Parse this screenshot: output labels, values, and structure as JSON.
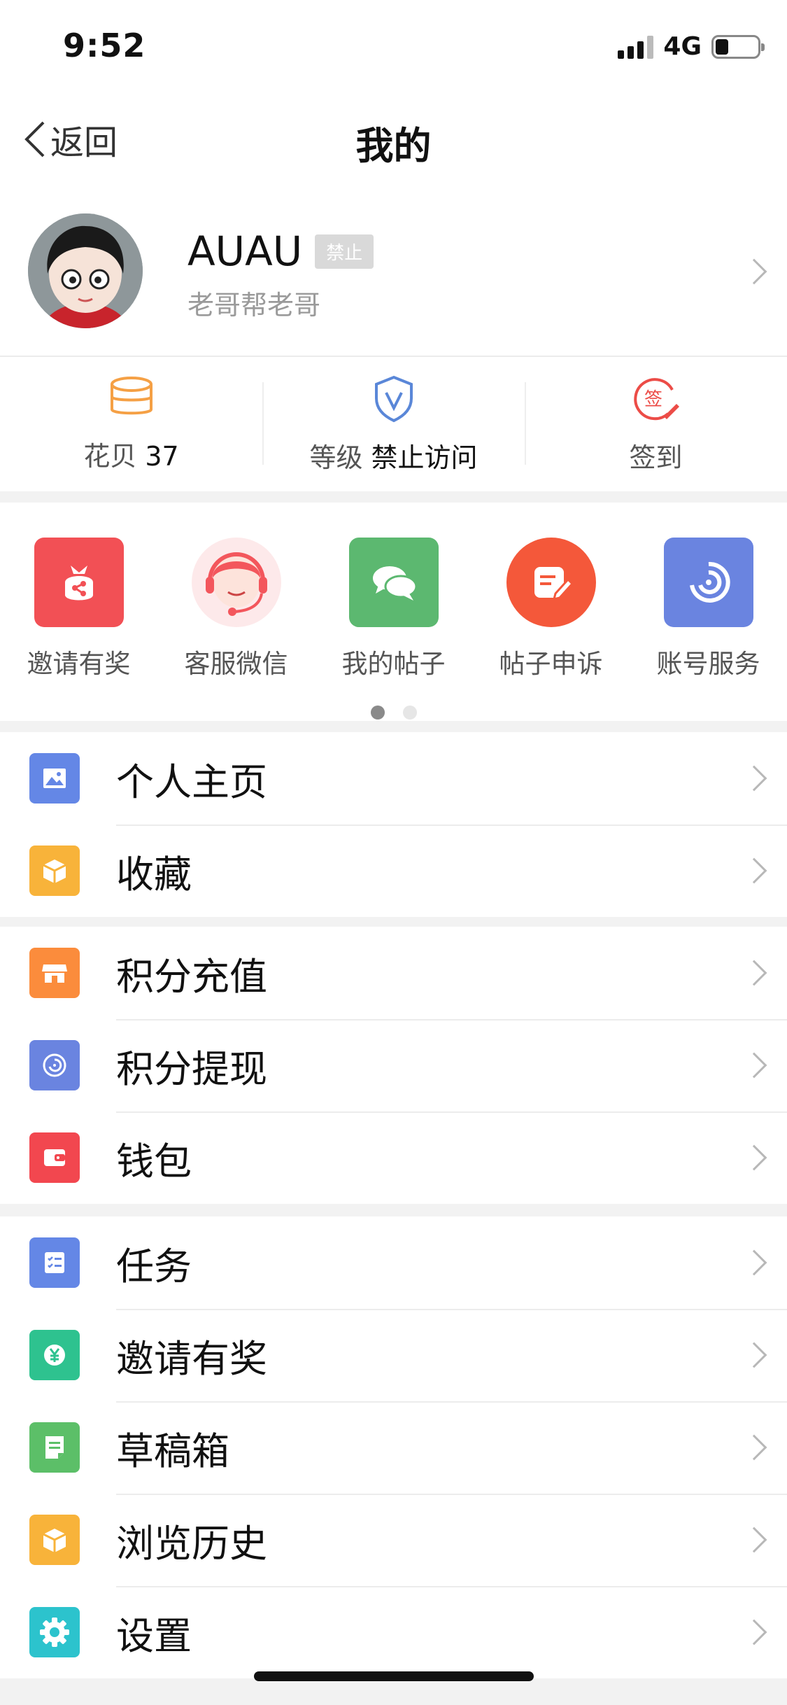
{
  "status_bar": {
    "time": "9:52",
    "network": "4G",
    "battery_level": 0.25
  },
  "nav": {
    "back_label": "返回",
    "title": "我的"
  },
  "profile": {
    "name": "AUAU",
    "badge": "禁止",
    "subtitle": "老哥帮老哥"
  },
  "stats": [
    {
      "label": "花贝",
      "value": "37",
      "icon": "coin-stack-icon",
      "color": "#f5a045"
    },
    {
      "label": "等级",
      "value": "禁止访问",
      "icon": "shield-v-icon",
      "color": "#5a87d8"
    },
    {
      "label": "签到",
      "value": "",
      "icon": "sign-in-icon",
      "color": "#ec4c47"
    }
  ],
  "quick_actions": {
    "items": [
      {
        "label": "邀请有奖",
        "icon": "gift-bag-icon",
        "color": "#f25055"
      },
      {
        "label": "客服微信",
        "icon": "customer-service-icon",
        "color": "#f3565c"
      },
      {
        "label": "我的帖子",
        "icon": "chat-bubbles-icon",
        "color": "#5cb870"
      },
      {
        "label": "帖子申诉",
        "icon": "edit-note-icon",
        "color": "#f4583a"
      },
      {
        "label": "账号服务",
        "icon": "swirl-icon",
        "color": "#6a84e0"
      }
    ],
    "pages": 2,
    "current_page": 1
  },
  "menu_groups": [
    [
      {
        "label": "个人主页",
        "icon": "image-icon",
        "color": "#6487e6"
      },
      {
        "label": "收藏",
        "icon": "box-icon",
        "color": "#f8b33a"
      }
    ],
    [
      {
        "label": "积分充值",
        "icon": "store-icon",
        "color": "#fb8c3c"
      },
      {
        "label": "积分提现",
        "icon": "swirl-icon",
        "color": "#6a84e0"
      },
      {
        "label": "钱包",
        "icon": "wallet-icon",
        "color": "#f2474f"
      }
    ],
    [
      {
        "label": "任务",
        "icon": "task-list-icon",
        "color": "#6487e6"
      },
      {
        "label": "邀请有奖",
        "icon": "yen-coin-icon",
        "color": "#2ec28f"
      },
      {
        "label": "草稿箱",
        "icon": "draft-icon",
        "color": "#5cbf68"
      },
      {
        "label": "浏览历史",
        "icon": "box-icon",
        "color": "#f8b33a"
      },
      {
        "label": "设置",
        "icon": "gear-icon",
        "color": "#2cc3cd"
      }
    ]
  ]
}
